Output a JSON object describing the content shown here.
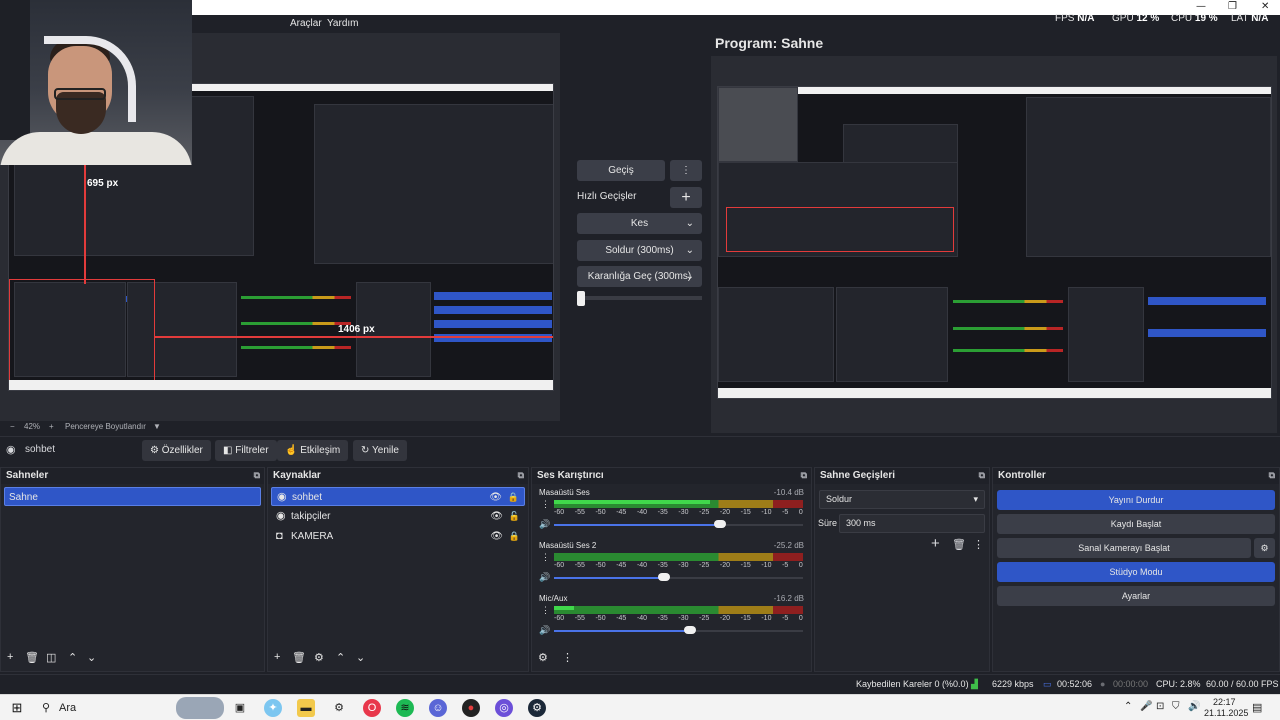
{
  "menu": {
    "tools": "Araçlar",
    "help": "Yardım"
  },
  "stats": {
    "fps_label": "FPS",
    "fps_value": "N/A",
    "gpu_label": "GPU",
    "gpu_value": "12 %",
    "cpu_label": "CPU",
    "cpu_value": "19 %",
    "lat_label": "LAT",
    "lat_value": "N/A"
  },
  "window_controls": {
    "minimize": "—",
    "restore": "❐",
    "close": "✕"
  },
  "preview": {
    "measure_width": "695 px",
    "measure_height": "1406 px",
    "zoom_value": "42%",
    "zoom_minus": "−",
    "zoom_plus": "+",
    "fit_label": "Pencereye Boyutlandır",
    "fit_arrow": "▼"
  },
  "program": {
    "title": "Program: Sahne"
  },
  "transitions_col": {
    "transition_button": "Geçiş",
    "quick_label": "Hızlı Geçişler",
    "quick_items": [
      "Kes",
      "Soldur (300ms)",
      "Karanlığa Geç (300ms)"
    ]
  },
  "source_toolbar": {
    "current_source": "sohbet",
    "properties": "Özellikler",
    "filters": "Filtreler",
    "interact": "Etkileşim",
    "refresh": "Yenile"
  },
  "scenes": {
    "title": "Sahneler",
    "items": [
      "Sahne"
    ]
  },
  "sources": {
    "title": "Kaynaklar",
    "items": [
      {
        "name": "sohbet",
        "icon": "globe-icon"
      },
      {
        "name": "takipçiler",
        "icon": "globe-icon"
      },
      {
        "name": "KAMERA",
        "icon": "camera-icon"
      }
    ]
  },
  "mixer": {
    "title": "Ses Karıştırıcı",
    "ticks": [
      "-60",
      "-55",
      "-50",
      "-45",
      "-40",
      "-35",
      "-30",
      "-25",
      "-20",
      "-15",
      "-10",
      "-5",
      "0"
    ],
    "channels": [
      {
        "name": "Masaüstü Ses",
        "db": "-10.4 dB",
        "level": 0.62,
        "volume": 0.66
      },
      {
        "name": "Masaüstü Ses 2",
        "db": "-25.2 dB",
        "level": 0.0,
        "volume": 0.44
      },
      {
        "name": "Mic/Aux",
        "db": "-16.2 dB",
        "level": 0.08,
        "volume": 0.54
      }
    ]
  },
  "scene_transitions": {
    "title": "Sahne Geçişleri",
    "selected": "Soldur",
    "duration_label": "Süre",
    "duration_value": "300 ms"
  },
  "controls": {
    "title": "Kontroller",
    "stop_stream": "Yayını Durdur",
    "start_recording": "Kaydı Başlat",
    "virtual_cam": "Sanal Kamerayı Başlat",
    "studio_mode": "Stüdyo Modu",
    "settings": "Ayarlar"
  },
  "status": {
    "dropped": "Kaybedilen Kareler 0 (%0.0)",
    "bitrate": "6229 kbps",
    "stream_time": "00:52:06",
    "rec_time": "00:00:00",
    "cpu": "CPU: 2.8%",
    "fps": "60.00 / 60.00 FPS"
  },
  "taskbar": {
    "search": "Ara",
    "time": "22:17",
    "date": "21.11.2025"
  },
  "colors": {
    "accent": "#2f56c7",
    "bg": "#1f2128",
    "panel": "#23252c"
  }
}
